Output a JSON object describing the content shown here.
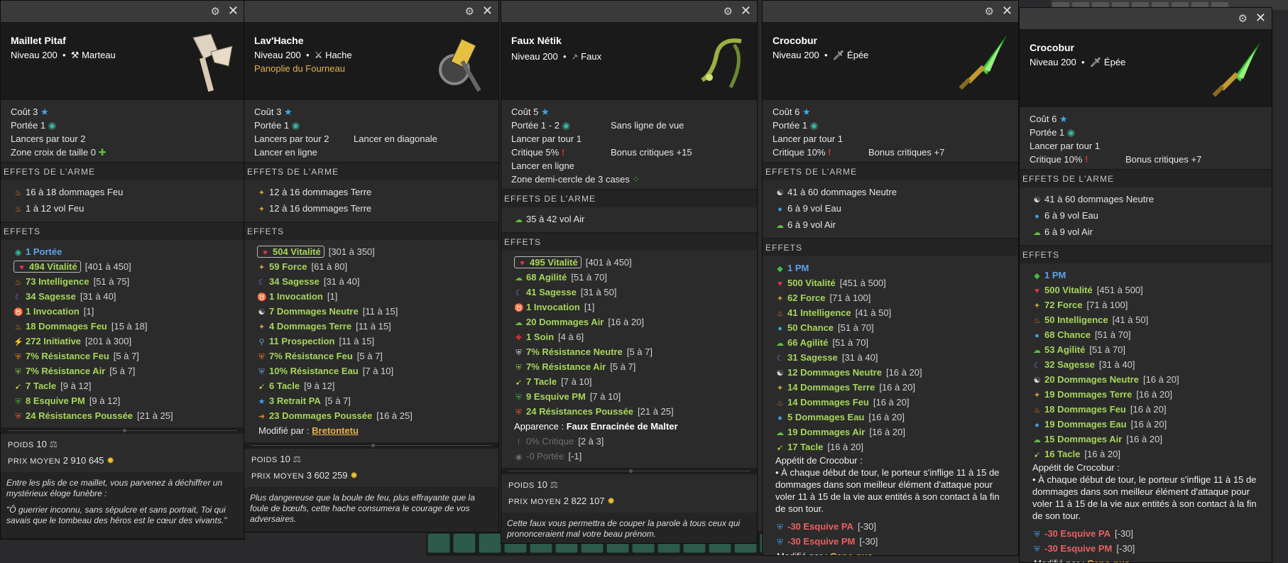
{
  "ui": {
    "settings_icon": "gear-icon",
    "close_icon": "close-icon"
  },
  "panels": [
    {
      "name": "Maillet Pitaf",
      "level": "Niveau 200",
      "type": "Marteau",
      "set": "",
      "stats": [
        [
          "Coût 3",
          ""
        ],
        [
          "Portée 1",
          ""
        ],
        [
          "Lancers par tour 2",
          ""
        ],
        [
          "Zone croix de taille 0",
          ""
        ]
      ],
      "weapon_header": "EFFETS DE L'ARME",
      "weapon": [
        "16 à 18 dommages Feu",
        "1 à 12 vol Feu"
      ],
      "effects_header": "EFFETS",
      "effects": [
        [
          "1 Portée",
          ""
        ],
        [
          "494 Vitalité",
          "[401 à 450]"
        ],
        [
          "73 Intelligence",
          "[51 à 75]"
        ],
        [
          "34 Sagesse",
          "[31 à 40]"
        ],
        [
          "1 Invocation",
          "[1]"
        ],
        [
          "18 Dommages Feu",
          "[15 à 18]"
        ],
        [
          "272 Initiative",
          "[201 à 300]"
        ],
        [
          "7% Résistance Feu",
          "[5 à 7]"
        ],
        [
          "7% Résistance Air",
          "[5 à 7]"
        ],
        [
          "7 Tacle",
          "[9 à 12]"
        ],
        [
          "8 Esquive PM",
          "[9 à 12]"
        ],
        [
          "24 Résistances Poussée",
          "[21 à 25]"
        ]
      ],
      "weight": "10",
      "price": "2 910 645",
      "description": [
        "Entre les plis de ce maillet, vous parvenez à déchiffrer un mystérieux éloge funèbre :",
        "\"Ô guerrier inconnu, sans sépulcre et sans portrait, Toi qui savais que le tombeau des héros est le cœur des vivants.\""
      ]
    },
    {
      "name": "Lav'Hache",
      "level": "Niveau 200",
      "type": "Hache",
      "set": "Panoplie du Fourneau",
      "stats": [
        [
          "Coût 3",
          ""
        ],
        [
          "Portée 1",
          ""
        ],
        [
          "Lancers par tour 2",
          "Lancer en diagonale"
        ],
        [
          "Lancer en ligne",
          ""
        ]
      ],
      "weapon_header": "EFFETS DE L'ARME",
      "weapon": [
        "12 à 16 dommages Terre",
        "12 à 16 dommages Terre"
      ],
      "effects_header": "EFFETS",
      "effects": [
        [
          "504 Vitalité",
          "[301 à 350]"
        ],
        [
          "59 Force",
          "[61 à 80]"
        ],
        [
          "34 Sagesse",
          "[31 à 40]"
        ],
        [
          "1 Invocation",
          "[1]"
        ],
        [
          "7 Dommages Neutre",
          "[11 à 15]"
        ],
        [
          "4 Dommages Terre",
          "[11 à 15]"
        ],
        [
          "11 Prospection",
          "[11 à 15]"
        ],
        [
          "7% Résistance Feu",
          "[5 à 7]"
        ],
        [
          "10% Résistance Eau",
          "[7 à 10]"
        ],
        [
          "6 Tacle",
          "[9 à 12]"
        ],
        [
          "3 Retrait PA",
          "[5 à 7]"
        ],
        [
          "23 Dommages Poussée",
          "[16 à 25]"
        ]
      ],
      "modified_label": "Modifié par :",
      "modified_by": "Bretontetu",
      "weight": "10",
      "price": "3 602 259",
      "description": [
        "Plus dangereuse que la boule de feu, plus effrayante que la foule de bœufs, cette hache consumera le courage de vos adversaires."
      ]
    },
    {
      "name": "Faux Nétik",
      "level": "Niveau 200",
      "type": "Faux",
      "set": "",
      "stats": [
        [
          "Coût 5",
          ""
        ],
        [
          "Portée 1 - 2",
          "Sans ligne de vue"
        ],
        [
          "Lancer par tour 1",
          ""
        ],
        [
          "Critique 5%",
          "Bonus critiques +15"
        ],
        [
          "Lancer en ligne",
          ""
        ],
        [
          "Zone demi-cercle de 3 cases",
          ""
        ]
      ],
      "weapon_header": "EFFETS DE L'ARME",
      "weapon": [
        "35 à 42 vol Air"
      ],
      "effects_header": "EFFETS",
      "effects": [
        [
          "495 Vitalité",
          "[401 à 450]"
        ],
        [
          "68 Agilité",
          "[51 à 70]"
        ],
        [
          "41 Sagesse",
          "[31 à 50]"
        ],
        [
          "1 Invocation",
          "[1]"
        ],
        [
          "20 Dommages Air",
          "[16 à 20]"
        ],
        [
          "1 Soin",
          "[4 à 6]"
        ],
        [
          "7% Résistance Neutre",
          "[5 à 7]"
        ],
        [
          "7% Résistance Air",
          "[5 à 7]"
        ],
        [
          "7 Tacle",
          "[7 à 10]"
        ],
        [
          "9 Esquive PM",
          "[7 à 10]"
        ],
        [
          "24 Résistances Poussée",
          "[21 à 25]"
        ]
      ],
      "appearance_label": "Apparence :",
      "appearance": "Faux Enracinée de Malter",
      "greyed": [
        [
          "0% Critique",
          "[2 à 3]"
        ],
        [
          "-0 Portée",
          "[-1]"
        ]
      ],
      "weight": "10",
      "price": "2 822 107",
      "description": [
        "Cette faux vous permettra de couper la parole à tous ceux qui prononceraient mal votre beau prénom."
      ]
    },
    {
      "name": "Crocobur",
      "level": "Niveau 200",
      "type": "Épée",
      "set": "",
      "stats": [
        [
          "Coût 6",
          ""
        ],
        [
          "Portée 1",
          ""
        ],
        [
          "Lancer par tour 1",
          ""
        ],
        [
          "Critique 10%",
          "Bonus critiques +7"
        ]
      ],
      "weapon_header": "EFFETS DE L'ARME",
      "weapon": [
        "41 à 60 dommages Neutre",
        "6 à 9 vol Eau",
        "6 à 9 vol Air"
      ],
      "effects_header": "EFFETS",
      "effects": [
        [
          "1 PM",
          ""
        ],
        [
          "500 Vitalité",
          "[451 à 500]"
        ],
        [
          "62 Force",
          "[71 à 100]"
        ],
        [
          "41 Intelligence",
          "[41 à 50]"
        ],
        [
          "50 Chance",
          "[51 à 70]"
        ],
        [
          "66 Agilité",
          "[51 à 70]"
        ],
        [
          "31 Sagesse",
          "[31 à 40]"
        ],
        [
          "12 Dommages Neutre",
          "[16 à 20]"
        ],
        [
          "14 Dommages Terre",
          "[16 à 20]"
        ],
        [
          "14 Dommages Feu",
          "[16 à 20]"
        ],
        [
          "5 Dommages Eau",
          "[16 à 20]"
        ],
        [
          "19 Dommages Air",
          "[16 à 20]"
        ],
        [
          "17 Tacle",
          "[16 à 20]"
        ]
      ],
      "appetite_title": "Appétit de Crocobur :",
      "appetite": "• À chaque début de tour, le porteur s'inflige 11 à 15 de dommages dans son meilleur élément d'attaque pour voler 11 à 15 de la vie aux entités à son contact à la fin de son tour.",
      "maluses": [
        [
          "-30 Esquive PA",
          "[-30]"
        ],
        [
          "-30 Esquive PM",
          "[-30]"
        ]
      ],
      "modified_label": "Modifié par :",
      "modified_by": "Cano-pus"
    },
    {
      "name": "Crocobur",
      "level": "Niveau 200",
      "type": "Épée",
      "set": "",
      "stats": [
        [
          "Coût 6",
          ""
        ],
        [
          "Portée 1",
          ""
        ],
        [
          "Lancer par tour 1",
          ""
        ],
        [
          "Critique 10%",
          "Bonus critiques +7"
        ]
      ],
      "weapon_header": "EFFETS DE L'ARME",
      "weapon": [
        "41 à 60 dommages Neutre",
        "6 à 9 vol Eau",
        "6 à 9 vol Air"
      ],
      "effects_header": "EFFETS",
      "effects": [
        [
          "1 PM",
          ""
        ],
        [
          "500 Vitalité",
          "[451 à 500]"
        ],
        [
          "72 Force",
          "[71 à 100]"
        ],
        [
          "50 Intelligence",
          "[41 à 50]"
        ],
        [
          "68 Chance",
          "[51 à 70]"
        ],
        [
          "53 Agilité",
          "[51 à 70]"
        ],
        [
          "32 Sagesse",
          "[31 à 40]"
        ],
        [
          "20 Dommages Neutre",
          "[16 à 20]"
        ],
        [
          "19 Dommages Terre",
          "[16 à 20]"
        ],
        [
          "18 Dommages Feu",
          "[16 à 20]"
        ],
        [
          "19 Dommages Eau",
          "[16 à 20]"
        ],
        [
          "15 Dommages Air",
          "[16 à 20]"
        ],
        [
          "16 Tacle",
          "[16 à 20]"
        ]
      ],
      "appetite_title": "Appétit de Crocobur :",
      "appetite": "• À chaque début de tour, le porteur s'inflige 11 à 15 de dommages dans son meilleur élément d'attaque pour voler 11 à 15 de la vie aux entités à son contact à la fin de son tour.",
      "maluses": [
        [
          "-30 Esquive PA",
          "[-30]"
        ],
        [
          "-30 Esquive PM",
          "[-30]"
        ]
      ],
      "modified_label": "Modifié par :",
      "modified_by": "Cano-pus"
    }
  ],
  "labels": {
    "weight": "POIDS",
    "price": "PRIX MOYEN"
  }
}
